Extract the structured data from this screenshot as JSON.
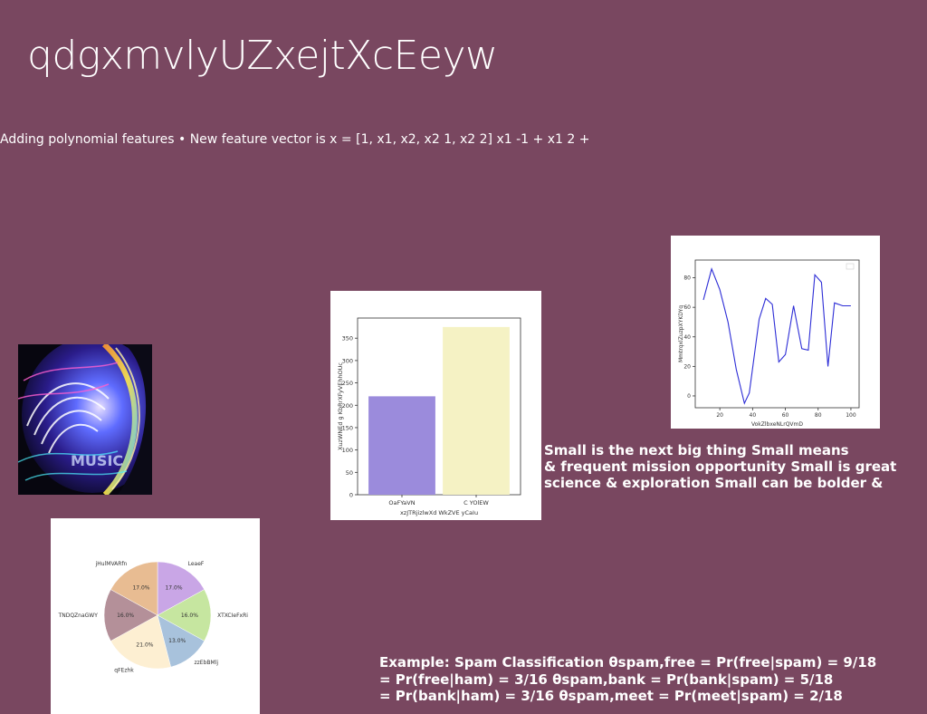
{
  "slide": {
    "title": "qdgxmvlyUZxejtXcEeyw",
    "subtitle": "Adding polynomial features • New feature vector is x = [1, x1, x2, x2 1, x2 2] x1 -1 + x1 2 +",
    "paragraph_small": [
      "Small is the next big thing Small means",
      "& frequent mission opportunity Small is great",
      "science & exploration Small can be bolder &"
    ],
    "paragraph_spam": [
      "Example: Spam Classification θspam,free = Pr(free|spam) = 9/18",
      "= Pr(free|ham) = 3/16 θspam,bank = Pr(bank|spam) = 5/18",
      "= Pr(bank|ham) = 3/16 θspam,meet = Pr(meet|spam) = 2/18"
    ],
    "photo_text": "MUSIC"
  },
  "chart_data": [
    {
      "type": "bar",
      "categories": [
        "OaFYaVN",
        "C YOlEW"
      ],
      "values": [
        220,
        375
      ],
      "colors": [
        "#9b8bdc",
        "#f5f2c4"
      ],
      "title": "",
      "xlabel": "xzJTRjizlwXd WkZVE yCaIu",
      "ylabel": "XuzWNEd g KbRrXFyVEhhOUc",
      "ylim": [
        0,
        395
      ],
      "yticks": [
        0,
        50,
        100,
        150,
        200,
        250,
        300,
        350
      ]
    },
    {
      "type": "line",
      "x": [
        10,
        15,
        20,
        25,
        30,
        35,
        40,
        45,
        50,
        55,
        60,
        65,
        70,
        75,
        80,
        85,
        90,
        95,
        100
      ],
      "y": [
        65,
        86,
        72,
        50,
        18,
        -5,
        2,
        52,
        66,
        62,
        23,
        28,
        61,
        32,
        31,
        82,
        77,
        20,
        63,
        61
      ],
      "series": [
        {
          "name": "",
          "x": [
            10,
            15,
            20,
            25,
            30,
            35,
            38,
            44,
            48,
            52,
            56,
            60,
            65,
            70,
            74,
            78,
            82,
            86,
            90,
            95,
            100
          ],
          "y": [
            65,
            86,
            72,
            50,
            18,
            -5,
            2,
            52,
            66,
            62,
            23,
            28,
            61,
            32,
            31,
            82,
            77,
            20,
            63,
            61,
            61
          ]
        }
      ],
      "color": "#2d2dd6",
      "title": "",
      "xlabel": "VokZlbxeNLrQVmD",
      "ylabel": "MmtrqxlZuzpXYKDYq",
      "xlim": [
        5,
        105
      ],
      "ylim": [
        -8,
        92
      ],
      "xticks": [
        20,
        40,
        60,
        80,
        100
      ],
      "yticks": [
        0,
        20,
        40,
        60,
        80
      ]
    },
    {
      "type": "pie",
      "labels": [
        "LeaeF",
        "XTXCIeFxRi",
        "zzEbBMlj",
        "qFEzhk",
        "TNDQZnaGWY",
        "jHulMVARfn"
      ],
      "values": [
        17.0,
        16.0,
        13.0,
        21.0,
        16.0,
        17.0
      ],
      "pct_labels": [
        "17.0%",
        "16.0%",
        "13.0%",
        "21.0%",
        "16.0%",
        "17.0%"
      ],
      "colors": [
        "#c9a6e6",
        "#c6e6a0",
        "#a8c2dc",
        "#fdefd2",
        "#b49099",
        "#e8bc92"
      ]
    }
  ]
}
